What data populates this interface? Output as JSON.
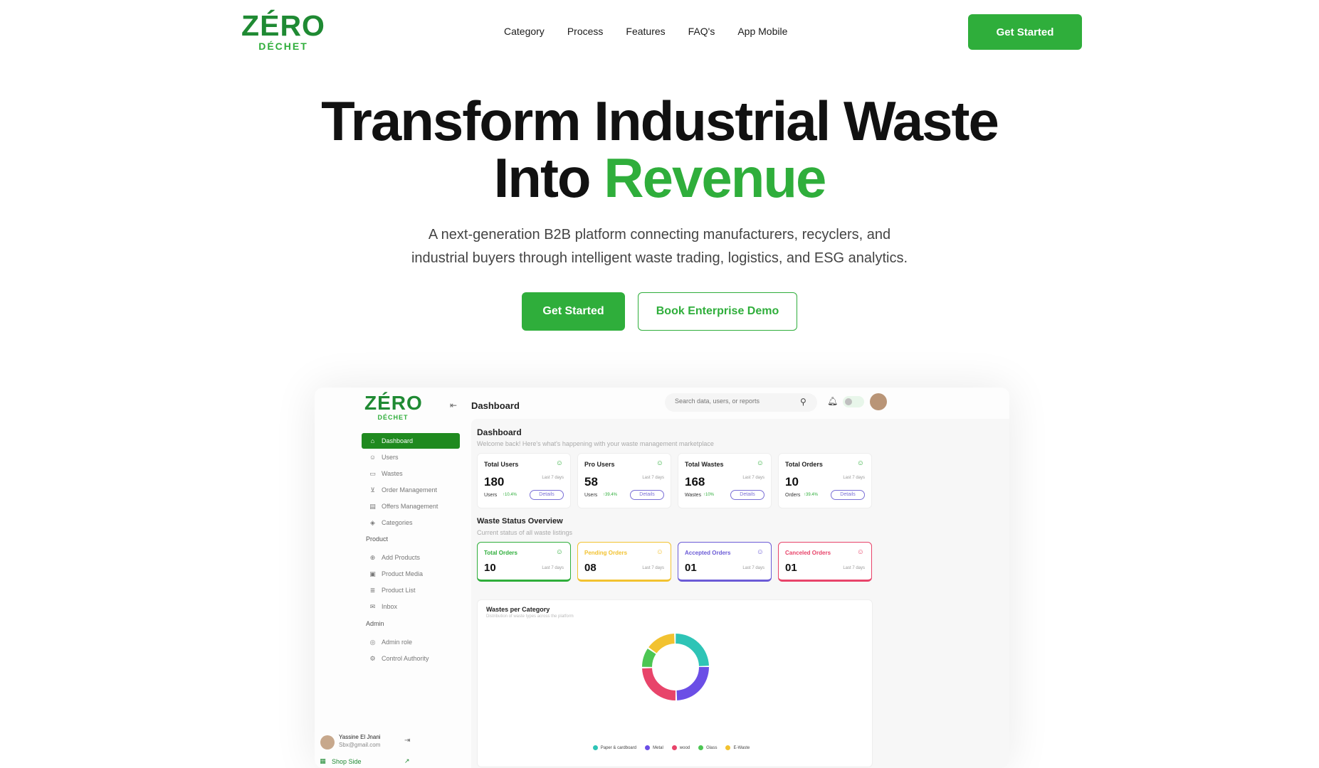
{
  "nav": {
    "logo": {
      "main": "ZÉRO",
      "sub": "DÉCHET"
    },
    "links": [
      "Category",
      "Process",
      "Features",
      "FAQ's",
      "App Mobile"
    ],
    "cta": "Get Started"
  },
  "hero": {
    "title_line1": "Transform Industrial Waste",
    "title_line2_plain": "Into ",
    "title_line2_accent": "Revenue",
    "subtitle_line1": "A next-generation B2B platform connecting manufacturers, recyclers, and",
    "subtitle_line2": "industrial buyers through intelligent waste trading, logistics, and ESG analytics.",
    "cta_primary": "Get Started",
    "cta_secondary": "Book Enterprise Demo"
  },
  "dashboard": {
    "logo": {
      "main": "ZÉRO",
      "sub": "DÉCHET"
    },
    "sidebar": {
      "items": [
        {
          "label": "Dashboard",
          "icon": "home-icon",
          "active": true
        },
        {
          "label": "Users",
          "icon": "users-icon"
        },
        {
          "label": "Wastes",
          "icon": "box-icon"
        },
        {
          "label": "Order Management",
          "icon": "cart-icon"
        },
        {
          "label": "Offers Management",
          "icon": "offer-icon"
        },
        {
          "label": "Categories",
          "icon": "categories-icon"
        }
      ],
      "product_section": "Product",
      "product_items": [
        {
          "label": "Add Products",
          "icon": "plus-circle-icon"
        },
        {
          "label": "Product Media",
          "icon": "image-icon"
        },
        {
          "label": "Product List",
          "icon": "list-icon"
        },
        {
          "label": "Inbox",
          "icon": "inbox-icon"
        }
      ],
      "admin_section": "Admin",
      "admin_items": [
        {
          "label": "Admin role",
          "icon": "admin-icon"
        },
        {
          "label": "Control Authority",
          "icon": "gear-icon"
        }
      ],
      "user": {
        "name": "Yassine El Jnani",
        "email": "Sbx@gmail.com"
      },
      "shop_side": "Shop Side"
    },
    "topbar": {
      "title": "Dashboard",
      "search_placeholder": "Search data, users, or reports"
    },
    "header": {
      "title": "Dashboard",
      "subtitle": "Welcome back! Here's what's happening with your waste management marketplace"
    },
    "stats": [
      {
        "title": "Total Users",
        "value": "180",
        "period": "Last 7 days",
        "unit": "Users",
        "change": "10.4%",
        "button": "Details"
      },
      {
        "title": "Pro Users",
        "value": "58",
        "period": "Last 7 days",
        "unit": "Users",
        "change": "39.4%",
        "button": "Details"
      },
      {
        "title": "Total Wastes",
        "value": "168",
        "period": "Last 7 days",
        "unit": "Wastes",
        "change": "10%",
        "button": "Details"
      },
      {
        "title": "Total Orders",
        "value": "10",
        "period": "Last 7 days",
        "unit": "Orders",
        "change": "39.4%",
        "button": "Details"
      }
    ],
    "status_overview": {
      "title": "Waste Status Overview",
      "subtitle": "Current status of all waste listings",
      "cards": [
        {
          "title": "Total Orders",
          "value": "10",
          "period": "Last 7 days",
          "color": "#2fae3b"
        },
        {
          "title": "Pending Orders",
          "value": "08",
          "period": "Last 7 days",
          "color": "#f2c230"
        },
        {
          "title": "Accepted Orders",
          "value": "01",
          "period": "Last 7 days",
          "color": "#6b5bd6"
        },
        {
          "title": "Canceled Orders",
          "value": "01",
          "period": "Last 7 days",
          "color": "#e8446a"
        }
      ]
    },
    "chart": {
      "title": "Wastes per Category",
      "subtitle": "Distribution of waste types across the platform"
    }
  },
  "chart_data": {
    "type": "pie",
    "categories": [
      "Paper & cardboard",
      "Metal",
      "wood",
      "Glass",
      "E-Waste"
    ],
    "values": [
      25,
      25,
      25,
      10,
      15
    ],
    "colors": [
      "#2ec4b6",
      "#6b4ee6",
      "#e8446a",
      "#4cc653",
      "#f2c230"
    ],
    "legend": "bottom"
  }
}
